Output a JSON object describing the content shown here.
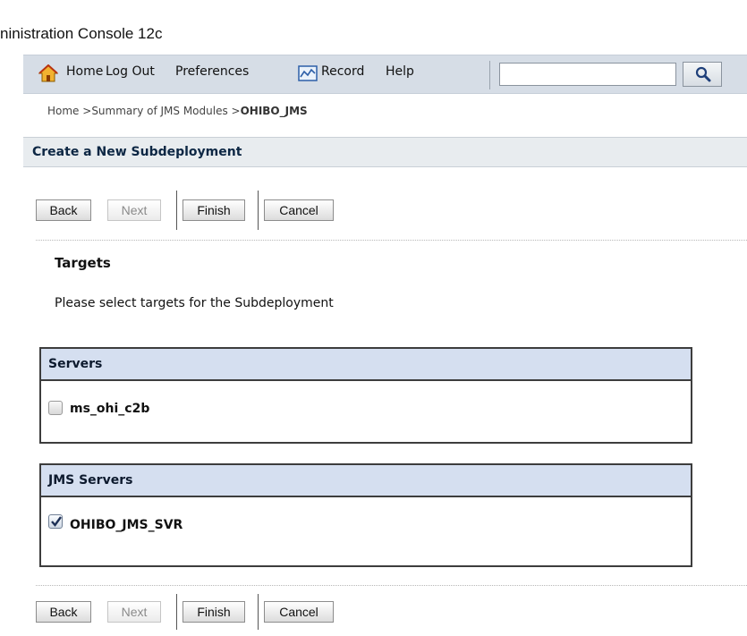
{
  "app": {
    "title": "ninistration Console 12c"
  },
  "toolbar": {
    "home_label": "Home",
    "logout_label": "Log Out",
    "preferences_label": "Preferences",
    "record_label": "Record",
    "help_label": "Help",
    "search": {
      "value": "",
      "placeholder": ""
    },
    "icons": {
      "home": "home-icon",
      "record": "record-icon",
      "search": "magnifier-icon"
    }
  },
  "breadcrumb": {
    "items": [
      "Home >",
      "Summary of JMS Modules >"
    ],
    "current": "OHIBO_JMS"
  },
  "panel": {
    "title": "Create a New Subdeployment"
  },
  "buttons": {
    "back": "Back",
    "next": "Next",
    "finish": "Finish",
    "cancel": "Cancel",
    "next_disabled": true
  },
  "section": {
    "heading": "Targets",
    "instructions": "Please select targets for the Subdeployment"
  },
  "servers_table": {
    "header": "Servers",
    "rows": [
      {
        "label": "ms_ohi_c2b",
        "checked": false
      }
    ]
  },
  "jms_servers_table": {
    "header": "JMS Servers",
    "rows": [
      {
        "label": "OHIBO_JMS_SVR",
        "checked": true
      }
    ]
  },
  "colors": {
    "toolbar_bg": "#d6dde6",
    "panel_header_bg": "#e8ecef",
    "panel_title": "#0d2744",
    "table_header_bg": "#d5dff0",
    "table_border": "#3d3d3d",
    "disabled_text": "#8a8a8a"
  }
}
